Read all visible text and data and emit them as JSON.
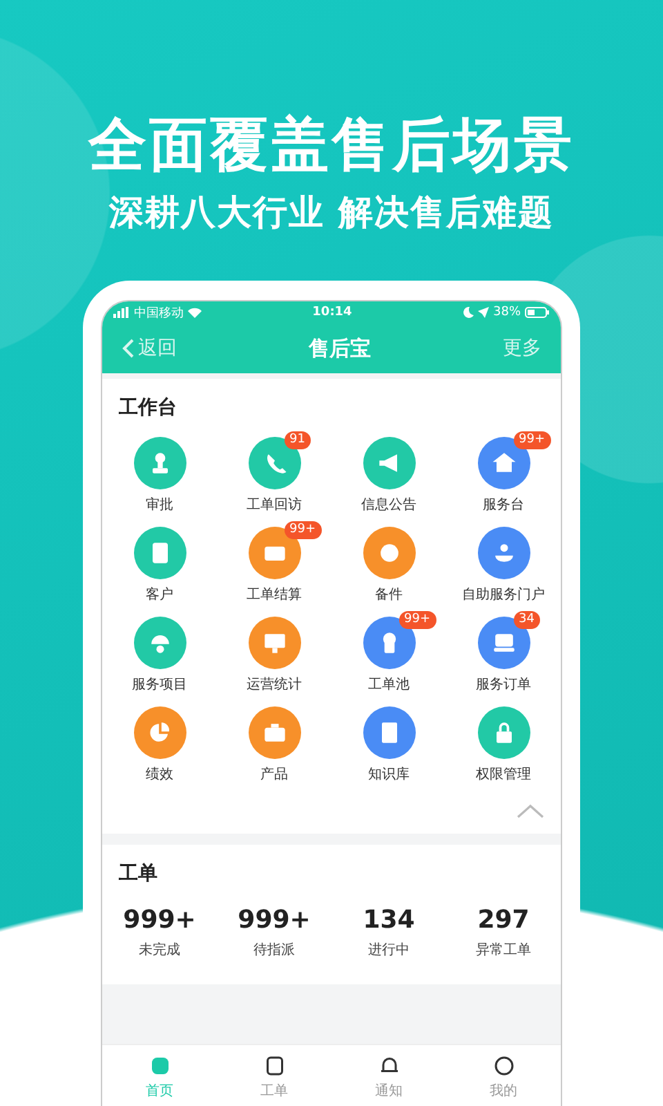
{
  "headline": "全面覆盖售后场景",
  "subheadline": "深耕八大行业 解决售后难题",
  "status_bar": {
    "carrier": "中国移动",
    "time": "10:14",
    "battery": "38%"
  },
  "nav": {
    "back": "返回",
    "title": "售后宝",
    "more": "更多"
  },
  "workbench": {
    "title": "工作台",
    "expanded": true,
    "items": [
      {
        "label": "审批",
        "color": "#22c9a6"
      },
      {
        "label": "工单回访",
        "color": "#22c9a6",
        "badge": "91"
      },
      {
        "label": "信息公告",
        "color": "#22c9a6"
      },
      {
        "label": "服务台",
        "color": "#4a8cf5",
        "badge": "99+"
      },
      {
        "label": "客户",
        "color": "#22c9a6"
      },
      {
        "label": "工单结算",
        "color": "#f7902a",
        "badge": "99+"
      },
      {
        "label": "备件",
        "color": "#f7902a"
      },
      {
        "label": "自助服务门户",
        "color": "#4a8cf5"
      },
      {
        "label": "服务项目",
        "color": "#22c9a6"
      },
      {
        "label": "运营统计",
        "color": "#f7902a"
      },
      {
        "label": "工单池",
        "color": "#4a8cf5",
        "badge": "99+"
      },
      {
        "label": "服务订单",
        "color": "#4a8cf5",
        "badge": "34"
      },
      {
        "label": "绩效",
        "color": "#f7902a"
      },
      {
        "label": "产品",
        "color": "#f7902a"
      },
      {
        "label": "知识库",
        "color": "#4a8cf5"
      },
      {
        "label": "权限管理",
        "color": "#22c9a6"
      }
    ]
  },
  "orders": {
    "title": "工单",
    "stats": [
      {
        "value": "999+",
        "label": "未完成"
      },
      {
        "value": "999+",
        "label": "待指派"
      },
      {
        "value": "134",
        "label": "进行中"
      },
      {
        "value": "297",
        "label": "异常工单"
      }
    ]
  },
  "tabs": [
    {
      "label": "首页",
      "selected": true
    },
    {
      "label": "工单",
      "selected": false
    },
    {
      "label": "通知",
      "selected": false
    },
    {
      "label": "我的",
      "selected": false
    }
  ]
}
